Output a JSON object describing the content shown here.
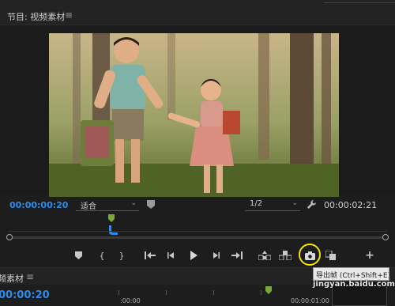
{
  "program_monitor": {
    "tab_title": "节目: 视频素材",
    "menu_glyph": "≡",
    "timecode_current": "00:00:00:20",
    "fit_select": {
      "value": "适合",
      "chevron": "⌄"
    },
    "resolution_select": {
      "value": "1/2",
      "chevron": "⌄"
    },
    "timecode_duration": "00:00:02:21",
    "marker_icon": "marker-icon",
    "settings_icon": "wrench-icon"
  },
  "transport": {
    "buttons": [
      {
        "name": "add-marker-button",
        "icon": "marker-icon"
      },
      {
        "name": "mark-in-button",
        "icon": "bracket-left-icon",
        "glyph": "{"
      },
      {
        "name": "mark-out-button",
        "icon": "bracket-right-icon",
        "glyph": "}"
      },
      {
        "name": "go-to-in-button",
        "icon": "go-to-in-icon"
      },
      {
        "name": "step-back-button",
        "icon": "step-back-icon"
      },
      {
        "name": "play-button",
        "icon": "play-icon"
      },
      {
        "name": "step-forward-button",
        "icon": "step-forward-icon"
      },
      {
        "name": "go-to-out-button",
        "icon": "go-to-out-icon"
      },
      {
        "name": "lift-button",
        "icon": "lift-icon"
      },
      {
        "name": "extract-button",
        "icon": "extract-icon"
      },
      {
        "name": "export-frame-button",
        "icon": "camera-icon"
      },
      {
        "name": "compare-button",
        "icon": "compare-icon"
      },
      {
        "name": "button-editor-button",
        "icon": "plus-icon",
        "glyph": "+"
      }
    ],
    "tooltip": "导出帧 (Ctrl+Shift+E)",
    "highlight_color": "#f4e300"
  },
  "sequence": {
    "tab_title": "频素材",
    "menu_glyph": "≡",
    "timecode_current": "00:00:20",
    "ruler_labels": [
      ":00:00",
      "00:00:01:00"
    ]
  },
  "watermark": "jingyan.baidu.com",
  "colors": {
    "timecode_blue": "#2d8ceb",
    "playhead_green": "#7aa63a",
    "playhead_blue": "#2d8ceb"
  }
}
